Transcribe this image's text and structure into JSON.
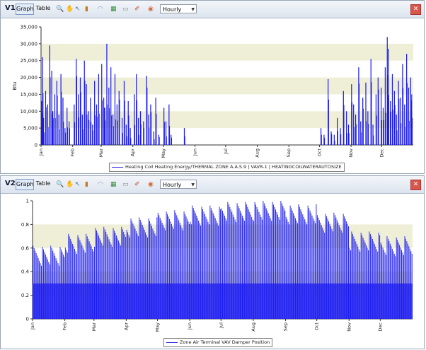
{
  "colors": {
    "series": "#1a1aee",
    "band": "#efefd8",
    "accent_close": "#d9564a"
  },
  "toolbar_icons": [
    "magnifier-icon",
    "hand-icon",
    "cursor-icon",
    "bar-chart-icon",
    "line-chart-icon",
    "heatmap-icon",
    "scale-icon",
    "tools-icon",
    "highlight-icon"
  ],
  "panels": [
    {
      "id": "V1",
      "tabs": {
        "graph": "Graph",
        "table": "Table"
      },
      "interval": "Hourly",
      "close_glyph": "✕",
      "legend": "Heating Coil Heating Energy/THERMAL ZONE A.A.S.9 | VAVR-1 | HEATINGCOILWATERAUTOSIZE",
      "chart_data": {
        "type": "bar",
        "ylabel": "Btu",
        "ylim": [
          0,
          35000
        ],
        "yticks": [
          "0",
          "5,000",
          "10,000",
          "15,000",
          "20,000",
          "25,000",
          "30,000",
          "35,000"
        ],
        "months": [
          "Jan",
          "Feb",
          "Mar",
          "Apr",
          "May",
          "Jun",
          "Jul",
          "Aug",
          "Sep",
          "Oct",
          "Nov",
          "Dec"
        ],
        "daily_peak": [
          {
            "day": 1,
            "value": 13000
          },
          {
            "day": 2,
            "value": 26000
          },
          {
            "day": 3,
            "value": 8000
          },
          {
            "day": 5,
            "value": 16000
          },
          {
            "day": 7,
            "value": 12000
          },
          {
            "day": 9,
            "value": 29500
          },
          {
            "day": 11,
            "value": 22000
          },
          {
            "day": 12,
            "value": 10000
          },
          {
            "day": 14,
            "value": 15000
          },
          {
            "day": 16,
            "value": 19000
          },
          {
            "day": 18,
            "value": 9000
          },
          {
            "day": 20,
            "value": 21000
          },
          {
            "day": 22,
            "value": 14000
          },
          {
            "day": 24,
            "value": 5000
          },
          {
            "day": 26,
            "value": 11000
          },
          {
            "day": 28,
            "value": 7000
          },
          {
            "day": 33,
            "value": 12000
          },
          {
            "day": 35,
            "value": 25500
          },
          {
            "day": 37,
            "value": 15000
          },
          {
            "day": 39,
            "value": 20000
          },
          {
            "day": 41,
            "value": 9000
          },
          {
            "day": 43,
            "value": 25000
          },
          {
            "day": 45,
            "value": 18000
          },
          {
            "day": 47,
            "value": 10000
          },
          {
            "day": 49,
            "value": 14000
          },
          {
            "day": 51,
            "value": 6000
          },
          {
            "day": 53,
            "value": 19000
          },
          {
            "day": 55,
            "value": 12000
          },
          {
            "day": 57,
            "value": 21000
          },
          {
            "day": 60,
            "value": 24000
          },
          {
            "day": 62,
            "value": 14000
          },
          {
            "day": 63,
            "value": 11000
          },
          {
            "day": 65,
            "value": 30000
          },
          {
            "day": 67,
            "value": 17000
          },
          {
            "day": 69,
            "value": 23000
          },
          {
            "day": 71,
            "value": 9000
          },
          {
            "day": 73,
            "value": 21000
          },
          {
            "day": 75,
            "value": 12000
          },
          {
            "day": 77,
            "value": 16000
          },
          {
            "day": 80,
            "value": 8000
          },
          {
            "day": 82,
            "value": 19000
          },
          {
            "day": 84,
            "value": 6000
          },
          {
            "day": 86,
            "value": 13000
          },
          {
            "day": 88,
            "value": 5000
          },
          {
            "day": 92,
            "value": 15000
          },
          {
            "day": 94,
            "value": 21000
          },
          {
            "day": 96,
            "value": 8000
          },
          {
            "day": 98,
            "value": 10000
          },
          {
            "day": 101,
            "value": 7000
          },
          {
            "day": 104,
            "value": 20500
          },
          {
            "day": 106,
            "value": 9000
          },
          {
            "day": 108,
            "value": 12000
          },
          {
            "day": 111,
            "value": 4000
          },
          {
            "day": 113,
            "value": 14000
          },
          {
            "day": 116,
            "value": 3000
          },
          {
            "day": 121,
            "value": 11000
          },
          {
            "day": 123,
            "value": 7000
          },
          {
            "day": 126,
            "value": 12000
          },
          {
            "day": 128,
            "value": 3000
          },
          {
            "day": 141,
            "value": 5000
          },
          {
            "day": 275,
            "value": 5000
          },
          {
            "day": 278,
            "value": 3000
          },
          {
            "day": 282,
            "value": 19500
          },
          {
            "day": 285,
            "value": 4000
          },
          {
            "day": 288,
            "value": 3000
          },
          {
            "day": 291,
            "value": 8000
          },
          {
            "day": 294,
            "value": 5000
          },
          {
            "day": 297,
            "value": 16000
          },
          {
            "day": 300,
            "value": 10000
          },
          {
            "day": 302,
            "value": 6000
          },
          {
            "day": 305,
            "value": 18000
          },
          {
            "day": 307,
            "value": 12000
          },
          {
            "day": 309,
            "value": 9000
          },
          {
            "day": 312,
            "value": 23000
          },
          {
            "day": 314,
            "value": 7000
          },
          {
            "day": 316,
            "value": 14000
          },
          {
            "day": 319,
            "value": 18500
          },
          {
            "day": 321,
            "value": 10000
          },
          {
            "day": 324,
            "value": 25500
          },
          {
            "day": 326,
            "value": 6000
          },
          {
            "day": 329,
            "value": 15000
          },
          {
            "day": 331,
            "value": 20000
          },
          {
            "day": 334,
            "value": 17000
          },
          {
            "day": 336,
            "value": 11000
          },
          {
            "day": 338,
            "value": 23000
          },
          {
            "day": 340,
            "value": 32000
          },
          {
            "day": 341,
            "value": 28500
          },
          {
            "day": 343,
            "value": 13000
          },
          {
            "day": 345,
            "value": 21000
          },
          {
            "day": 347,
            "value": 16000
          },
          {
            "day": 349,
            "value": 9000
          },
          {
            "day": 351,
            "value": 19000
          },
          {
            "day": 353,
            "value": 14000
          },
          {
            "day": 355,
            "value": 24000
          },
          {
            "day": 357,
            "value": 12000
          },
          {
            "day": 359,
            "value": 27000
          },
          {
            "day": 361,
            "value": 17000
          },
          {
            "day": 363,
            "value": 20000
          },
          {
            "day": 364,
            "value": 15000
          }
        ]
      }
    },
    {
      "id": "V2",
      "tabs": {
        "graph": "Graph",
        "table": "Table"
      },
      "interval": "Hourly",
      "close_glyph": "✕",
      "legend": "Zone Air Terminal VAV Damper Position",
      "chart_data": {
        "type": "bar",
        "ylabel": "",
        "ylim": [
          0,
          1
        ],
        "yticks": [
          "0",
          "0.2",
          "0.4",
          "0.6",
          "0.8",
          "1"
        ],
        "months": [
          "Jan",
          "Feb",
          "Mar",
          "Apr",
          "May",
          "Jun",
          "Jul",
          "Aug",
          "Sep",
          "Oct",
          "Nov",
          "Dec"
        ],
        "base_level": 0.3,
        "daily_peak_by_month": [
          0.62,
          0.72,
          0.78,
          0.86,
          0.92,
          0.96,
          0.99,
          1.0,
          0.97,
          0.9,
          0.74,
          0.7
        ]
      }
    }
  ]
}
